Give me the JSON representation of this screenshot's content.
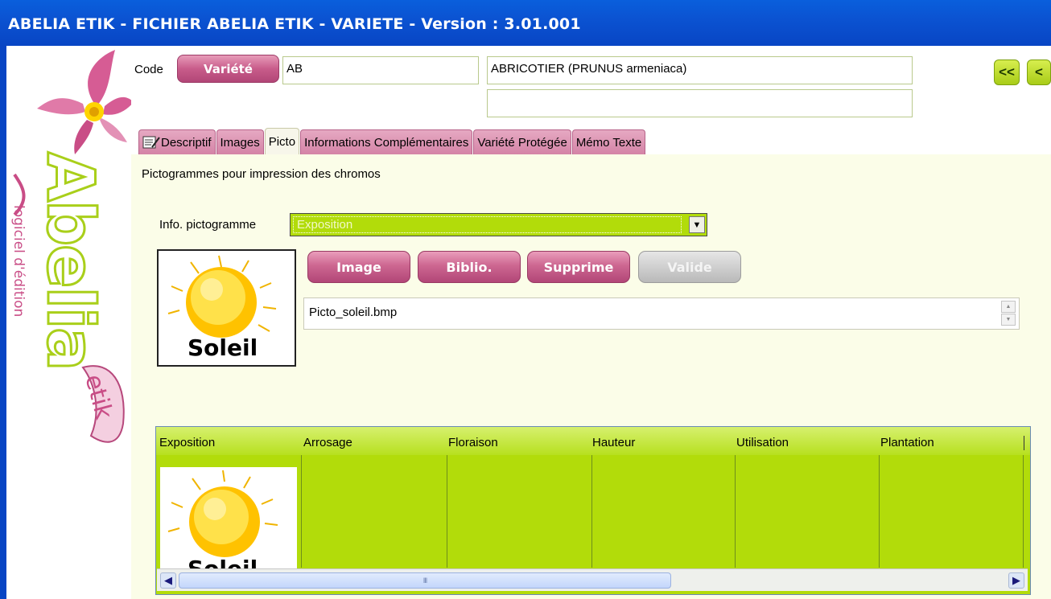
{
  "window": {
    "title": "ABELIA ETIK  -  FICHIER ABELIA ETIK  -  VARIETE  -  Version : 3.01.001"
  },
  "logo": {
    "brand": "Abelia",
    "sub": "etik",
    "tagline": "logiciel d'édition"
  },
  "header": {
    "code_label": "Code",
    "variete_button": "Variété",
    "code_value": "AB",
    "name_value": "ABRICOTIER   (PRUNUS armeniaca)",
    "name2_value": "",
    "nav_first": "<<",
    "nav_prev": "<"
  },
  "tabs": [
    {
      "label": "Descriptif"
    },
    {
      "label": "Images"
    },
    {
      "label": "Picto"
    },
    {
      "label": "Informations Complémentaires"
    },
    {
      "label": "Variété Protégée"
    },
    {
      "label": "Mémo Texte"
    }
  ],
  "picto": {
    "caption": "Pictogrammes pour impression des chromos",
    "info_label": "Info. pictogramme",
    "selected_info": "Exposition",
    "image_caption": "Soleil",
    "buttons": {
      "image": "Image",
      "biblio": "Biblio.",
      "supprime": "Supprime",
      "valide": "Valide"
    },
    "filename": "Picto_soleil.bmp"
  },
  "grid": {
    "columns": [
      "Exposition",
      "Arrosage",
      "Floraison",
      "Hauteur",
      "Utilisation",
      "Plantation"
    ],
    "row_image_caption": "Soleil",
    "scroll_grip": "III"
  },
  "colors": {
    "titlebar": "#0b53d2",
    "pink": "#c85c8a",
    "lime": "#b2dc0a",
    "panel": "#fbfde8"
  }
}
